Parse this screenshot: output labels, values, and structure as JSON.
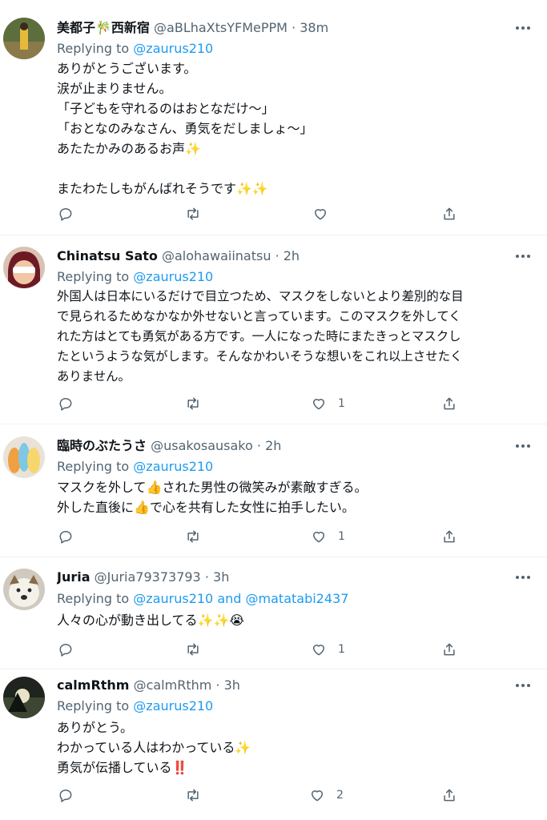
{
  "tweets": [
    {
      "name": "美都子🎋西新宿",
      "handle": "@aBLhaXtsYFMePPM",
      "time": "38m",
      "replying_prefix": "Replying to",
      "mentions": [
        "@zaurus210"
      ],
      "lines": [
        "ありがとうございます。",
        "涙が止まりません。",
        "「子どもを守れるのはおとなだけ〜」",
        "「おとなのみなさん、勇気をだしましょ〜」",
        "あたたかみのあるお声✨",
        "",
        "またわたしもがんばれそうです✨✨"
      ],
      "like_count": ""
    },
    {
      "name": "Chinatsu Sato",
      "handle": "@alohawaiinatsu",
      "time": "2h",
      "replying_prefix": "Replying to",
      "mentions": [
        "@zaurus210"
      ],
      "lines": [
        "外国人は日本にいるだけで目立つため、マスクをしないとより差別的な目",
        "で見られるためなかなか外せないと言っています。このマスクを外してく",
        "れた方はとても勇気がある方です。一人になった時にまたきっとマスクし",
        "たというような気がします。そんなかわいそうな想いをこれ以上させたく",
        "ありません。"
      ],
      "like_count": "1"
    },
    {
      "name": "臨時のぶたうさ",
      "handle": "@usakosausako",
      "time": "2h",
      "replying_prefix": "Replying to",
      "mentions": [
        "@zaurus210"
      ],
      "lines": [
        "マスクを外して👍された男性の微笑みが素敵すぎる。",
        "外した直後に👍で心を共有した女性に拍手したい。"
      ],
      "like_count": "1"
    },
    {
      "name": "Juria",
      "handle": "@Juria79373793",
      "time": "3h",
      "replying_prefix": "Replying to",
      "mentions": [
        "@zaurus210",
        "@matatabi2437"
      ],
      "mention_joiner": "and",
      "lines": [
        "人々の心が動き出してる✨✨😭"
      ],
      "like_count": "1"
    },
    {
      "name": "calmRthm",
      "handle": "@calmRthm",
      "time": "3h",
      "replying_prefix": "Replying to",
      "mentions": [
        "@zaurus210"
      ],
      "lines": [
        "ありがとう。",
        "わかっている人はわかっている✨",
        "勇気が伝播している‼️"
      ],
      "like_count": "2"
    }
  ],
  "icons": {
    "reply": "comment-bubble-icon",
    "retweet": "retweet-arrows-icon",
    "like": "heart-outline-icon",
    "share": "share-upload-icon",
    "more": "three-dots-icon"
  },
  "colors": {
    "text": "#0f1419",
    "secondary": "#536471",
    "link": "#1d9bf0",
    "divider": "#eff3f4"
  }
}
